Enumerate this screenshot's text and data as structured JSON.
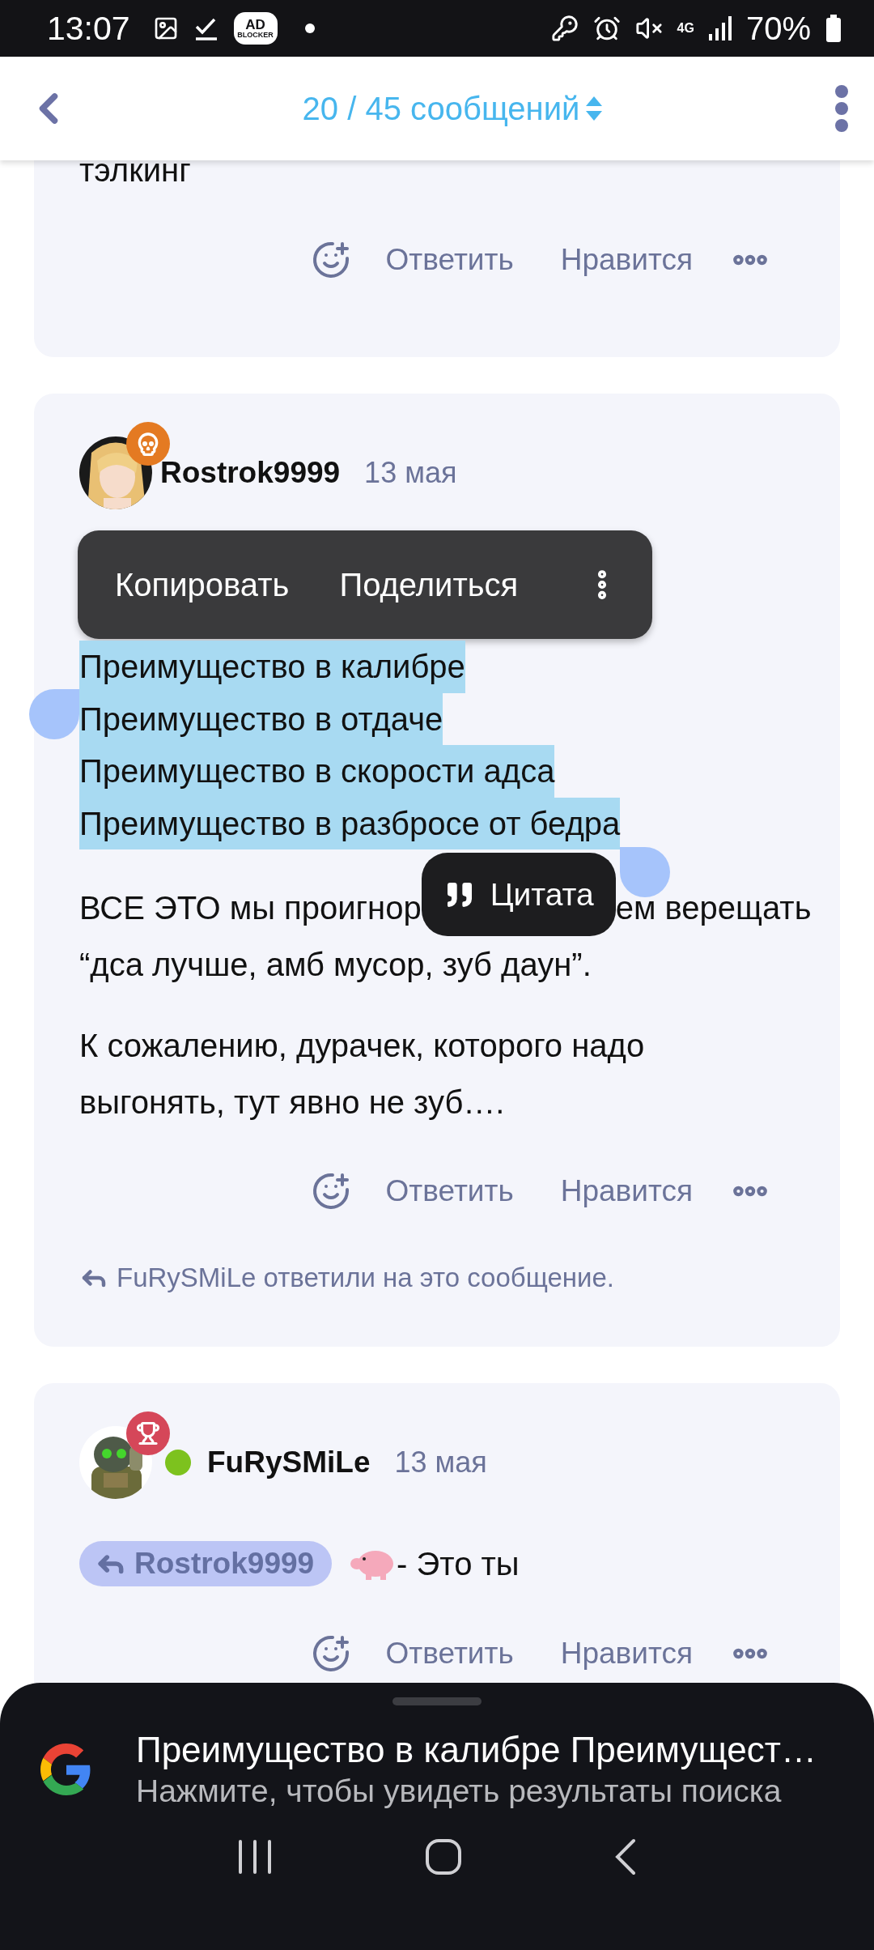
{
  "status_bar": {
    "time": "13:07",
    "adblock": {
      "top": "AD",
      "bottom": "BLOCKER"
    },
    "network": "4G",
    "battery": "70%"
  },
  "header": {
    "title": "20 / 45 сообщений"
  },
  "posts": [
    {
      "kind": "partial",
      "paragraphs": [
        {
          "lines": [
            [
              "тэлкинг"
            ]
          ]
        }
      ],
      "actions": {
        "reply": "Ответить",
        "like": "Нравится"
      }
    },
    {
      "kind": "full",
      "author": {
        "name": "Rostrok9999",
        "date": "13 мая",
        "badge": {
          "kind": "skull"
        },
        "online": false
      },
      "selection_menu": {
        "items": [
          "Копировать",
          "Поделиться"
        ]
      },
      "lines": [
        {
          "text": "Преимущество в калибре",
          "selected": true
        },
        {
          "text": "Преимущество в отдаче",
          "selected": true
        },
        {
          "text": "Преимущество в скорости адса",
          "selected": true
        },
        {
          "text": "Преимущество в разбросе от бедра",
          "selected": true
        }
      ],
      "quote_button": "Цитата",
      "paragraphs": [
        {
          "lines": [
            [
              "ВСЕ ЭТО мы проигнор",
              "ем верещать"
            ],
            [
              "“дса лучше, амб мусор, зуб даун”."
            ]
          ]
        },
        {
          "lines": [
            [
              "К сожалению, дурачек, которого надо выгонять, тут явно не зуб…."
            ]
          ]
        }
      ],
      "actions": {
        "reply": "Ответить",
        "like": "Нравится"
      },
      "reply_note": "FuRySMiLe ответили на это сообщение."
    },
    {
      "kind": "full",
      "author": {
        "name": "FuRySMiLe",
        "date": "13 мая",
        "badge": {
          "kind": "trophy"
        },
        "online": true
      },
      "quote_chip": "Rostrok9999",
      "message": "- Это ты",
      "actions": {
        "reply": "Ответить",
        "like": "Нравится"
      }
    }
  ],
  "search_sheet": {
    "title": "Преимущество в калибре Преимущест…",
    "subtitle": "Нажмите, чтобы увидеть результаты поиска"
  }
}
